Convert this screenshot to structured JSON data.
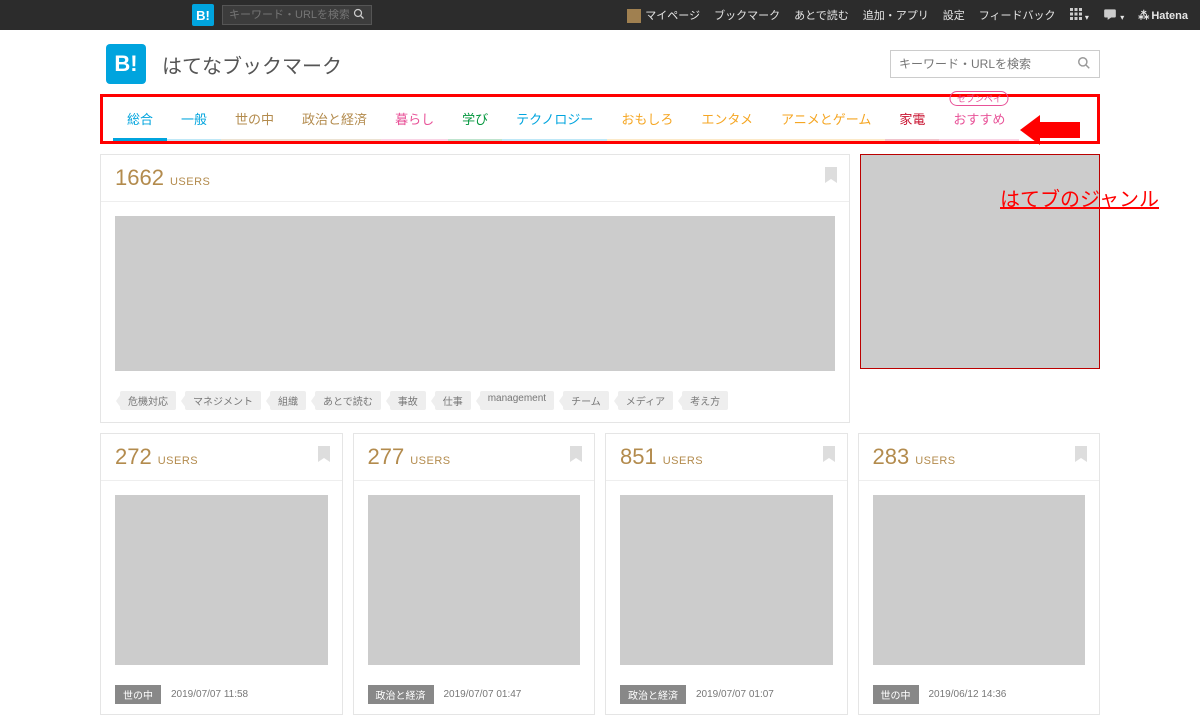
{
  "topbar": {
    "search_placeholder": "キーワード・URLを検索",
    "links": {
      "mypage": "マイページ",
      "bookmark": "ブックマーク",
      "readlater": "あとで読む",
      "add": "追加・アプリ",
      "settings": "設定",
      "feedback": "フィードバック",
      "hatena": "Hatena"
    }
  },
  "site": {
    "logo_text": "B!",
    "title": "はてなブックマーク",
    "search_placeholder": "キーワード・URLを検索"
  },
  "categories": [
    {
      "label": "総合",
      "color": "#00a4de",
      "active": true
    },
    {
      "label": "一般",
      "color": "#00a4de"
    },
    {
      "label": "世の中",
      "color": "#b38b4d"
    },
    {
      "label": "政治と経済",
      "color": "#b38b4d"
    },
    {
      "label": "暮らし",
      "color": "#e85298"
    },
    {
      "label": "学び",
      "color": "#00953b"
    },
    {
      "label": "テクノロジー",
      "color": "#00a4de"
    },
    {
      "label": "おもしろ",
      "color": "#f5a623"
    },
    {
      "label": "エンタメ",
      "color": "#f5a623"
    },
    {
      "label": "アニメとゲーム",
      "color": "#f5a623"
    },
    {
      "label": "家電",
      "color": "#c8102e"
    },
    {
      "label": "おすすめ",
      "color": "#e85298",
      "badge": "セブンペイ"
    }
  ],
  "annotation": {
    "arrow_label": "はてブのジャンル"
  },
  "hero": {
    "count": "1662",
    "users": "USERS",
    "tags": [
      "危機対応",
      "マネジメント",
      "組織",
      "あとで読む",
      "事故",
      "仕事",
      "management",
      "チーム",
      "メディア",
      "考え方"
    ]
  },
  "cards": [
    {
      "count": "272",
      "users": "USERS",
      "cat": "世の中",
      "date": "2019/07/07 11:58"
    },
    {
      "count": "277",
      "users": "USERS",
      "cat": "政治と経済",
      "date": "2019/07/07 01:47"
    },
    {
      "count": "851",
      "users": "USERS",
      "cat": "政治と経済",
      "date": "2019/07/07 01:07"
    },
    {
      "count": "283",
      "users": "USERS",
      "cat": "世の中",
      "date": "2019/06/12 14:36"
    }
  ]
}
